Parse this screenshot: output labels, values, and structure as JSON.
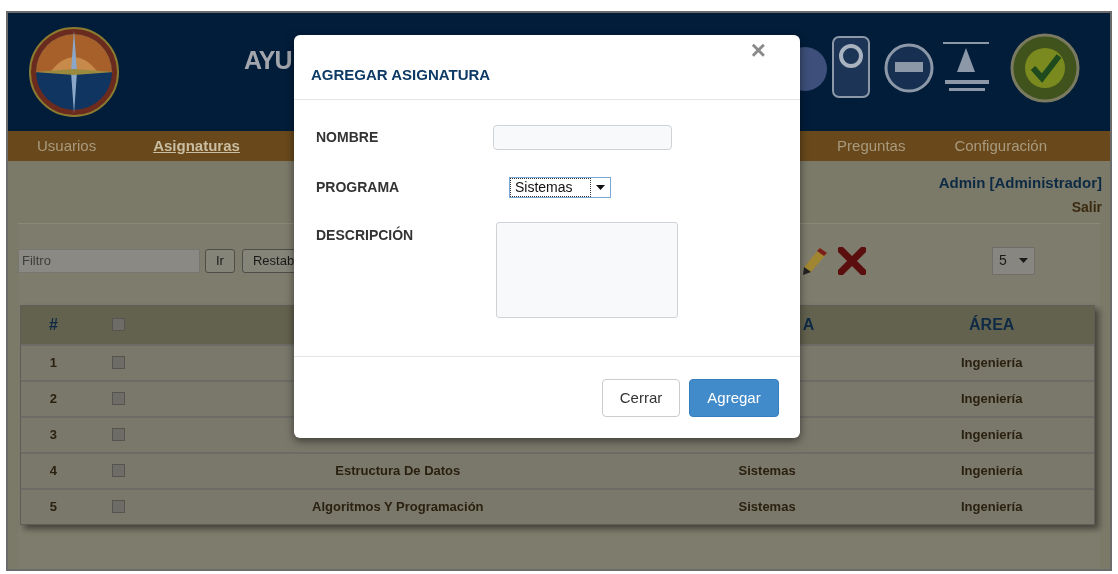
{
  "header": {
    "title": "AYU"
  },
  "nav": [
    {
      "label": "Usuarios",
      "selected": false
    },
    {
      "label": "Asignaturas",
      "selected": true
    },
    {
      "label": "Preguntas",
      "selected": false
    },
    {
      "label": "Configuración",
      "selected": false
    }
  ],
  "user": {
    "name": "Admin [Administrador]",
    "logout": "Salir"
  },
  "toolbar": {
    "filter_placeholder": "Filtro",
    "buttons": [
      "Ir",
      "Restab"
    ],
    "page_size": "5"
  },
  "table": {
    "header": {
      "number": "#",
      "checked": false,
      "column_4": "A",
      "column_5": "ÁREA"
    },
    "rows": [
      {
        "number": "1",
        "checked": false,
        "area": "Ingeniería"
      },
      {
        "number": "2",
        "checked": false,
        "area": "Ingeniería"
      },
      {
        "number": "3",
        "checked": false,
        "area": "Ingeniería"
      },
      {
        "number": "4",
        "checked": false,
        "name": "Estructura De Datos",
        "program": "Sistemas",
        "area": "Ingeniería"
      },
      {
        "number": "5",
        "checked": false,
        "name": "Algoritmos Y Programación",
        "program": "Sistemas",
        "area": "Ingeniería"
      }
    ]
  },
  "modal": {
    "title": "AGREGAR ASIGNATURA",
    "close": "×",
    "fields": [
      {
        "kind": "text",
        "label": "NOMBRE"
      },
      {
        "kind": "select",
        "label": "PROGRAMA",
        "value": "Sistemas"
      },
      {
        "kind": "textarea",
        "label": "DESCRIPCIÓN"
      }
    ],
    "buttons": [
      {
        "kind": "secondary",
        "label": "Cerrar"
      },
      {
        "kind": "primary",
        "label": "Agregar"
      }
    ]
  }
}
